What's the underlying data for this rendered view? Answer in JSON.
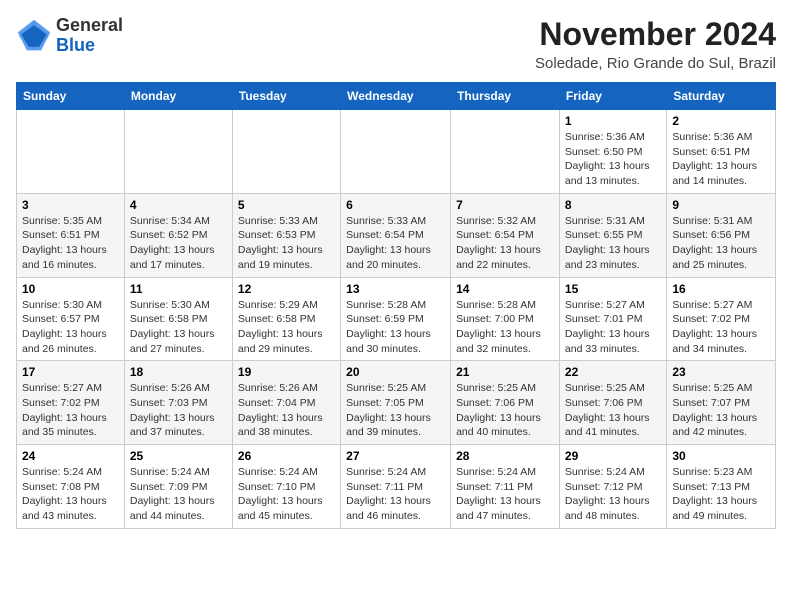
{
  "header": {
    "logo_line1": "General",
    "logo_line2": "Blue",
    "month_title": "November 2024",
    "subtitle": "Soledade, Rio Grande do Sul, Brazil"
  },
  "weekdays": [
    "Sunday",
    "Monday",
    "Tuesday",
    "Wednesday",
    "Thursday",
    "Friday",
    "Saturday"
  ],
  "weeks": [
    [
      {
        "day": "",
        "info": ""
      },
      {
        "day": "",
        "info": ""
      },
      {
        "day": "",
        "info": ""
      },
      {
        "day": "",
        "info": ""
      },
      {
        "day": "",
        "info": ""
      },
      {
        "day": "1",
        "info": "Sunrise: 5:36 AM\nSunset: 6:50 PM\nDaylight: 13 hours\nand 13 minutes."
      },
      {
        "day": "2",
        "info": "Sunrise: 5:36 AM\nSunset: 6:51 PM\nDaylight: 13 hours\nand 14 minutes."
      }
    ],
    [
      {
        "day": "3",
        "info": "Sunrise: 5:35 AM\nSunset: 6:51 PM\nDaylight: 13 hours\nand 16 minutes."
      },
      {
        "day": "4",
        "info": "Sunrise: 5:34 AM\nSunset: 6:52 PM\nDaylight: 13 hours\nand 17 minutes."
      },
      {
        "day": "5",
        "info": "Sunrise: 5:33 AM\nSunset: 6:53 PM\nDaylight: 13 hours\nand 19 minutes."
      },
      {
        "day": "6",
        "info": "Sunrise: 5:33 AM\nSunset: 6:54 PM\nDaylight: 13 hours\nand 20 minutes."
      },
      {
        "day": "7",
        "info": "Sunrise: 5:32 AM\nSunset: 6:54 PM\nDaylight: 13 hours\nand 22 minutes."
      },
      {
        "day": "8",
        "info": "Sunrise: 5:31 AM\nSunset: 6:55 PM\nDaylight: 13 hours\nand 23 minutes."
      },
      {
        "day": "9",
        "info": "Sunrise: 5:31 AM\nSunset: 6:56 PM\nDaylight: 13 hours\nand 25 minutes."
      }
    ],
    [
      {
        "day": "10",
        "info": "Sunrise: 5:30 AM\nSunset: 6:57 PM\nDaylight: 13 hours\nand 26 minutes."
      },
      {
        "day": "11",
        "info": "Sunrise: 5:30 AM\nSunset: 6:58 PM\nDaylight: 13 hours\nand 27 minutes."
      },
      {
        "day": "12",
        "info": "Sunrise: 5:29 AM\nSunset: 6:58 PM\nDaylight: 13 hours\nand 29 minutes."
      },
      {
        "day": "13",
        "info": "Sunrise: 5:28 AM\nSunset: 6:59 PM\nDaylight: 13 hours\nand 30 minutes."
      },
      {
        "day": "14",
        "info": "Sunrise: 5:28 AM\nSunset: 7:00 PM\nDaylight: 13 hours\nand 32 minutes."
      },
      {
        "day": "15",
        "info": "Sunrise: 5:27 AM\nSunset: 7:01 PM\nDaylight: 13 hours\nand 33 minutes."
      },
      {
        "day": "16",
        "info": "Sunrise: 5:27 AM\nSunset: 7:02 PM\nDaylight: 13 hours\nand 34 minutes."
      }
    ],
    [
      {
        "day": "17",
        "info": "Sunrise: 5:27 AM\nSunset: 7:02 PM\nDaylight: 13 hours\nand 35 minutes."
      },
      {
        "day": "18",
        "info": "Sunrise: 5:26 AM\nSunset: 7:03 PM\nDaylight: 13 hours\nand 37 minutes."
      },
      {
        "day": "19",
        "info": "Sunrise: 5:26 AM\nSunset: 7:04 PM\nDaylight: 13 hours\nand 38 minutes."
      },
      {
        "day": "20",
        "info": "Sunrise: 5:25 AM\nSunset: 7:05 PM\nDaylight: 13 hours\nand 39 minutes."
      },
      {
        "day": "21",
        "info": "Sunrise: 5:25 AM\nSunset: 7:06 PM\nDaylight: 13 hours\nand 40 minutes."
      },
      {
        "day": "22",
        "info": "Sunrise: 5:25 AM\nSunset: 7:06 PM\nDaylight: 13 hours\nand 41 minutes."
      },
      {
        "day": "23",
        "info": "Sunrise: 5:25 AM\nSunset: 7:07 PM\nDaylight: 13 hours\nand 42 minutes."
      }
    ],
    [
      {
        "day": "24",
        "info": "Sunrise: 5:24 AM\nSunset: 7:08 PM\nDaylight: 13 hours\nand 43 minutes."
      },
      {
        "day": "25",
        "info": "Sunrise: 5:24 AM\nSunset: 7:09 PM\nDaylight: 13 hours\nand 44 minutes."
      },
      {
        "day": "26",
        "info": "Sunrise: 5:24 AM\nSunset: 7:10 PM\nDaylight: 13 hours\nand 45 minutes."
      },
      {
        "day": "27",
        "info": "Sunrise: 5:24 AM\nSunset: 7:11 PM\nDaylight: 13 hours\nand 46 minutes."
      },
      {
        "day": "28",
        "info": "Sunrise: 5:24 AM\nSunset: 7:11 PM\nDaylight: 13 hours\nand 47 minutes."
      },
      {
        "day": "29",
        "info": "Sunrise: 5:24 AM\nSunset: 7:12 PM\nDaylight: 13 hours\nand 48 minutes."
      },
      {
        "day": "30",
        "info": "Sunrise: 5:23 AM\nSunset: 7:13 PM\nDaylight: 13 hours\nand 49 minutes."
      }
    ]
  ]
}
